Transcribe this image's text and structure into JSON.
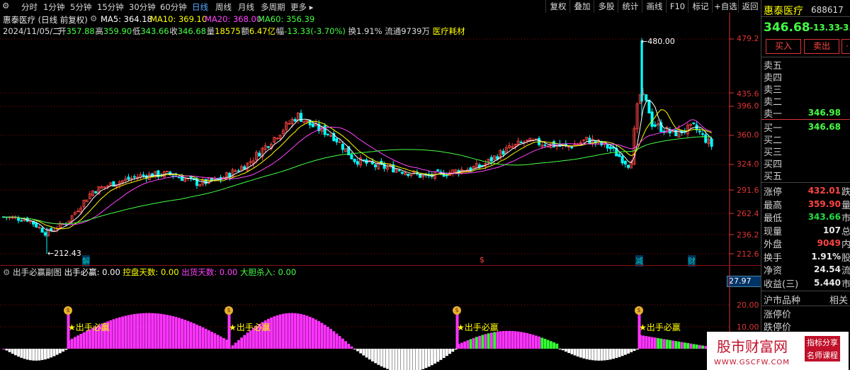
{
  "toolbar": {
    "periods": [
      "分时",
      "1分钟",
      "5分钟",
      "15分钟",
      "30分钟",
      "60分钟",
      "日线",
      "周线",
      "月线",
      "多周期",
      "更多 ▸"
    ],
    "active": "日线",
    "right_buttons": [
      "复权",
      "叠加",
      "多股",
      "统计",
      "画线",
      "F10",
      "标记",
      "+自选",
      "返回"
    ]
  },
  "header": {
    "title": "惠泰医疗 (日线 前复权)",
    "ma5": "MA5: 364.18",
    "ma10": "MA10: 369.10",
    "ma20": "MA20: 368.00",
    "ma60": "MA60: 356.39",
    "date": "2024/11/05/二",
    "open_label": "开",
    "open": "357.88",
    "high_label": "高",
    "high": "359.90",
    "low_label": "低",
    "low": "343.66",
    "close_label": "收",
    "close": "346.68",
    "vol_label": "量",
    "vol": "18575",
    "amt_label": "额",
    "amt": "6.47亿",
    "chg_label": "幅",
    "chg": "-13.33(-3.70%)",
    "turnover": "换1.91%",
    "float": "流通9739万",
    "sector": "医疗耗材"
  },
  "price_axis": [
    "479.2",
    "435.6",
    "396.0",
    "360.0",
    "324.0",
    "291.6",
    "262.4",
    "236.2",
    "212.6"
  ],
  "annotations": {
    "high_mark": "480.00",
    "low_mark": "212.43",
    "events": [
      "解",
      "$",
      "减",
      "财"
    ]
  },
  "indicator": {
    "name": "出手必赢副图",
    "label1": "出手必赢: 0.00",
    "label2": "控盘天数: 0.00",
    "label3": "出货天数: 0.00",
    "label4": "大胆杀入: 0.00",
    "cursor_value": "27.97",
    "axis": [
      "20.00",
      "10.00"
    ],
    "signal_text": "★出手必赢",
    "signal_icon": "money-bag-icon"
  },
  "right_panel": {
    "stock_name": "惠泰医疗",
    "stock_code": "688617",
    "price": "346.68",
    "change": "-13.33",
    "change_pct": "-3.",
    "buy_btn": "买入",
    "sell_btn": "卖出",
    "sell_levels": [
      "卖五",
      "卖四",
      "卖三",
      "卖二",
      "卖一"
    ],
    "sell1_price": "346.98",
    "buy_levels": [
      "买一",
      "买二",
      "买三",
      "买四",
      "买五"
    ],
    "buy1_price": "346.68",
    "stats": [
      {
        "label": "涨停",
        "value": "432.01",
        "cut": "跌",
        "color": "#ff4444"
      },
      {
        "label": "最高",
        "value": "359.90",
        "cut": "量",
        "color": "#ff4444"
      },
      {
        "label": "最低",
        "value": "343.66",
        "cut": "市",
        "color": "#22dd44"
      },
      {
        "label": "现量",
        "value": "107",
        "cut": "总",
        "color": "#e8e8e8"
      },
      {
        "label": "外盘",
        "value": "9049",
        "cut": "内",
        "color": "#ff4444"
      },
      {
        "label": "换手",
        "value": "1.91%",
        "cut": "股",
        "color": "#e8e8e8"
      },
      {
        "label": "净资",
        "value": "24.54",
        "cut": "流",
        "color": "#e8e8e8"
      },
      {
        "label": "收益(三)",
        "value": "5.440",
        "cut": "市",
        "color": "#e8e8e8"
      }
    ],
    "market": "沪市品种",
    "related": "相关",
    "limit_up": "涨停价",
    "limit_down": "跌停价"
  },
  "watermark": {
    "title": "股市财富网",
    "tag1": "指标分享",
    "tag2": "名师课程",
    "url": "WWW.GSCFW.COM"
  },
  "colors": {
    "up": "#ff4444",
    "down": "#00ffff",
    "ma5": "#ffffff",
    "ma10": "#ffff00",
    "ma20": "#ff44ff",
    "ma60": "#44ff44",
    "grid": "#8b1010"
  }
}
